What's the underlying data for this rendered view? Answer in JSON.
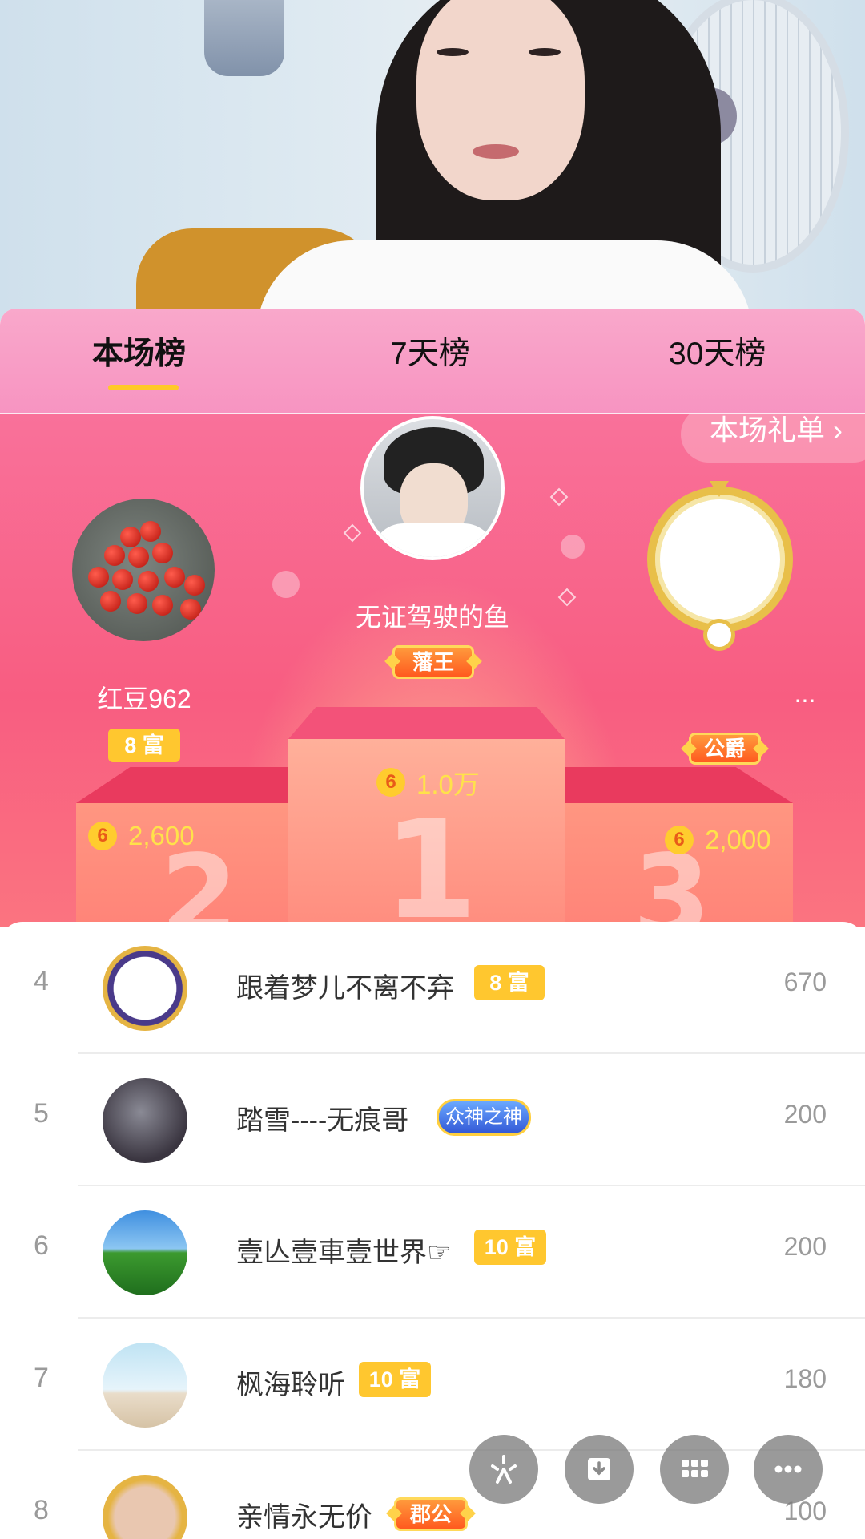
{
  "tabs": [
    {
      "label": "本场榜",
      "active": true
    },
    {
      "label": "7天榜",
      "active": false
    },
    {
      "label": "30天榜",
      "active": false
    }
  ],
  "gift_list_link": "本场礼单 ›",
  "podium": {
    "first": {
      "rank": "1",
      "name": "无证驾驶的鱼",
      "badge": "藩王",
      "coins": "1.0万"
    },
    "second": {
      "rank": "2",
      "name": "红豆962",
      "badge": "8 富",
      "coins": "2,600"
    },
    "third": {
      "rank": "3",
      "name": "...",
      "badge": "公爵",
      "coins": "2,000"
    }
  },
  "coin_symbol": "6",
  "rows": [
    {
      "rank": "4",
      "name": "跟着梦儿不离不弃",
      "badge": "8 富",
      "badge_type": "rich",
      "value": "670"
    },
    {
      "rank": "5",
      "name": "踏雪----无痕哥",
      "badge": "众神之神",
      "badge_type": "god",
      "value": "200"
    },
    {
      "rank": "6",
      "name": "壹亾壹車壹世界☞",
      "badge": "10 富",
      "badge_type": "rich",
      "value": "200"
    },
    {
      "rank": "7",
      "name": "枫海聆听",
      "badge": "10 富",
      "badge_type": "rich",
      "value": "180"
    },
    {
      "rank": "8",
      "name": "亲情永无价",
      "badge": "郡公",
      "badge_type": "noble",
      "value": "100"
    }
  ],
  "colors": {
    "tab_bg": "#f794c1",
    "podium_bg": "#f85d81",
    "rich_badge": "#ffc72f",
    "coin_text": "#ffe24a",
    "underline": "#ffc928"
  },
  "fab_icons": [
    "sparkle-icon",
    "download-icon",
    "grid-icon",
    "more-icon"
  ]
}
